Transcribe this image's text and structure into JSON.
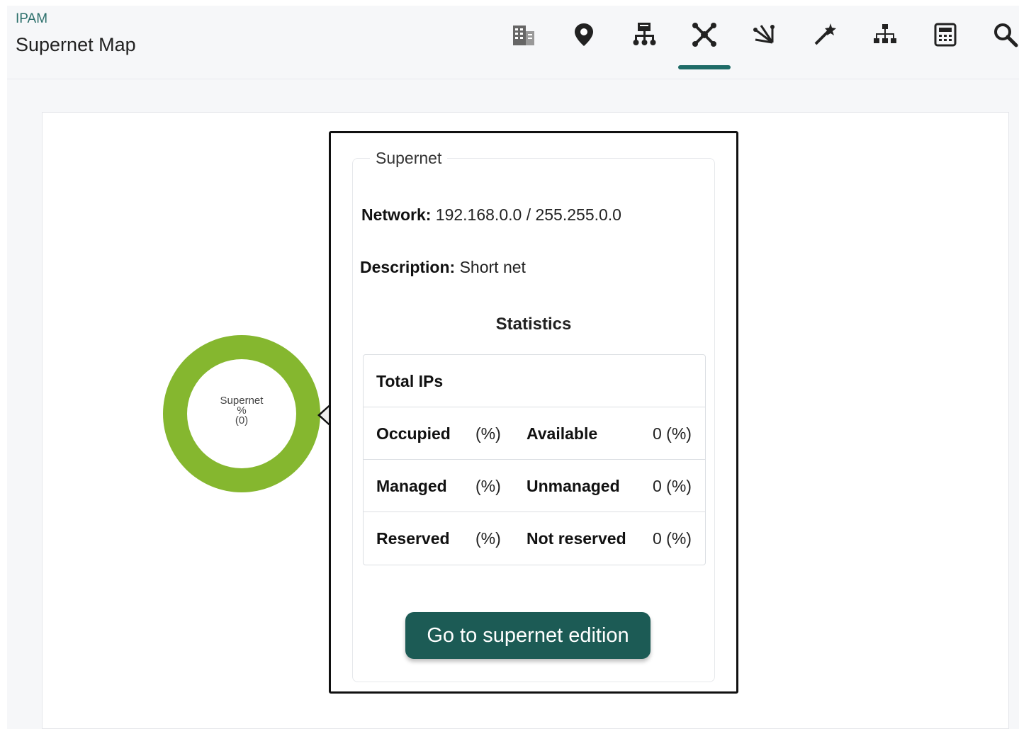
{
  "header": {
    "breadcrumb": "IPAM",
    "title": "Supernet Map",
    "toolbar": [
      {
        "icon": "building-icon",
        "active": false
      },
      {
        "icon": "location-pin-icon",
        "active": false
      },
      {
        "icon": "network-tree-icon",
        "active": false
      },
      {
        "icon": "supernet-map-icon",
        "active": true
      },
      {
        "icon": "scatter-icon",
        "active": false
      },
      {
        "icon": "magic-wand-icon",
        "active": false
      },
      {
        "icon": "hierarchy-icon",
        "active": false
      },
      {
        "icon": "calculator-icon",
        "active": false
      },
      {
        "icon": "search-icon",
        "active": false
      }
    ],
    "accent_color": "#1e6b67"
  },
  "node": {
    "label": "Supernet",
    "percent": "%",
    "count": "(0)",
    "color": "#85b72f"
  },
  "popup": {
    "legend": "Supernet",
    "network_label": "Network:",
    "network_value": "192.168.0.0 / 255.255.0.0",
    "description_label": "Description:",
    "description_value": "Short net",
    "statistics_title": "Statistics",
    "total_ips_label": "Total IPs",
    "rows": [
      {
        "label1": "Occupied",
        "value1": "(%)",
        "label2": "Available",
        "value2": "0 (%)"
      },
      {
        "label1": "Managed",
        "value1": "(%)",
        "label2": "Unmanaged",
        "value2": "0 (%)"
      },
      {
        "label1": "Reserved",
        "value1": "(%)",
        "label2": "Not reserved",
        "value2": "0 (%)"
      }
    ],
    "button_label": "Go to supernet edition",
    "button_color": "#1c5b55"
  }
}
